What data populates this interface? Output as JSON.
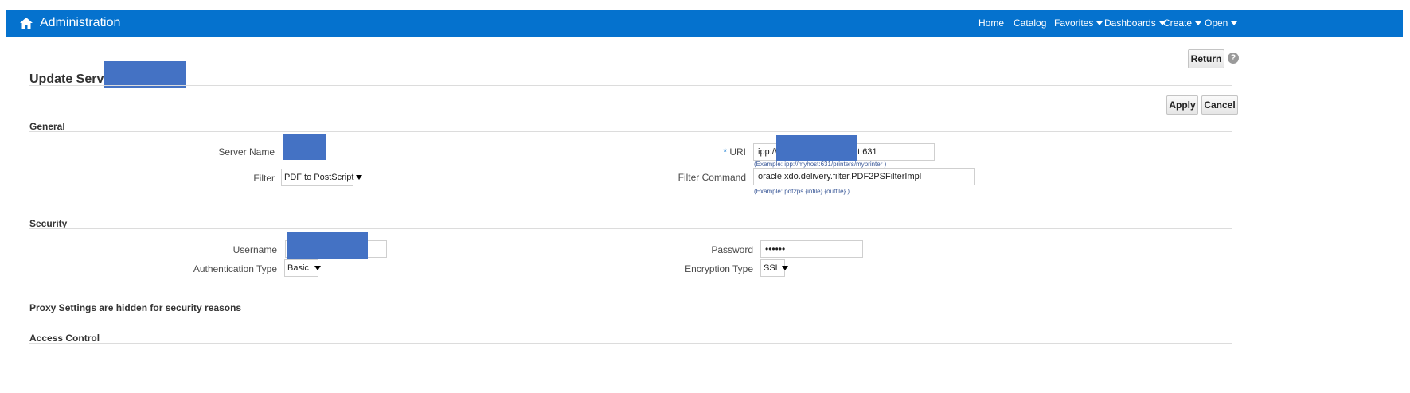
{
  "colors": {
    "topbar": "#0572ce",
    "redaction": "#4472c4"
  },
  "header": {
    "title": "Administration",
    "home_icon": "home-icon",
    "nav": [
      "Home",
      "Catalog",
      "Favorites",
      "Dashboards",
      "Create",
      "Open"
    ]
  },
  "page": {
    "title": "Update Server:",
    "return_label": "Return",
    "apply_label": "Apply",
    "cancel_label": "Cancel",
    "help_glyph": "?"
  },
  "general": {
    "heading": "General",
    "server_name_label": "Server Name",
    "filter_label": "Filter",
    "filter_value": "PDF to PostScript",
    "uri_required": "*",
    "uri_label": "URI",
    "uri_value_start": "ipp://",
    "uri_value_end": "et:631",
    "uri_hint": "(Example: ipp://myhost:631/printers/myprinter )",
    "filter_command_label": "Filter Command",
    "filter_command_value": "oracle.xdo.delivery.filter.PDF2PSFilterImpl",
    "filter_command_hint": "(Example: pdf2ps {infile} {outfile} )"
  },
  "security": {
    "heading": "Security",
    "username_label": "Username",
    "auth_type_label": "Authentication Type",
    "auth_type_value": "Basic",
    "password_label": "Password",
    "password_value": "••••••",
    "encryption_label": "Encryption Type",
    "encryption_value": "SSL"
  },
  "proxy": {
    "heading": "Proxy Settings are hidden for security reasons"
  },
  "access": {
    "heading": "Access Control"
  }
}
